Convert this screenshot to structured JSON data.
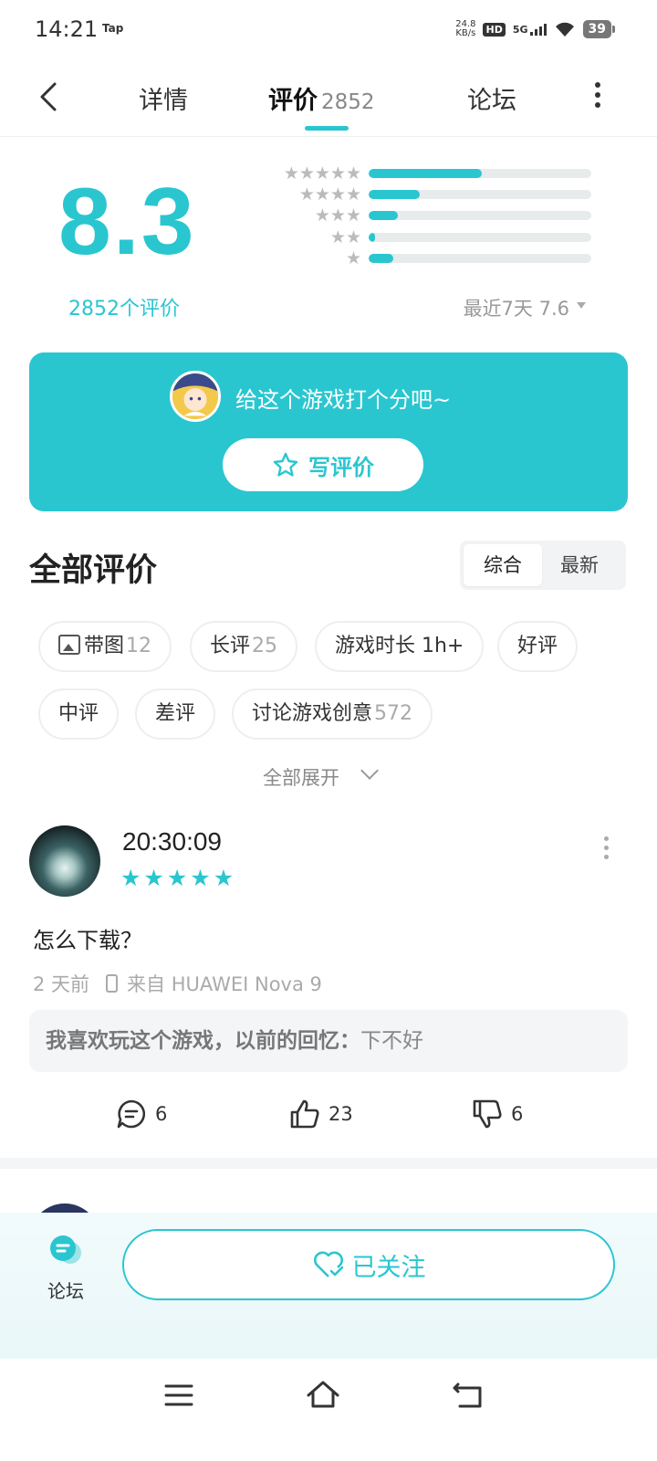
{
  "status_bar": {
    "time": "14:21",
    "carrier_tag": "Tap",
    "net_speed_value": "24.8",
    "net_speed_unit": "KB/s",
    "hd": "HD",
    "network": "5G",
    "battery": "39"
  },
  "nav": {
    "tabs": [
      {
        "label": "详情"
      },
      {
        "label": "评价",
        "count": "2852"
      },
      {
        "label": "论坛"
      }
    ],
    "active_tab": "评价"
  },
  "rating": {
    "score": "8.3",
    "count_label": "2852个评价",
    "recent_label": "最近7天 7.6",
    "distribution": [
      {
        "stars": 5,
        "fraction": 0.51
      },
      {
        "stars": 4,
        "fraction": 0.23
      },
      {
        "stars": 3,
        "fraction": 0.13
      },
      {
        "stars": 2,
        "fraction": 0.03
      },
      {
        "stars": 1,
        "fraction": 0.11
      }
    ],
    "accent_color": "#2ac6d0"
  },
  "cta": {
    "prompt": "给这个游戏打个分吧~",
    "button_label": "写评价"
  },
  "reviews_section": {
    "title": "全部评价",
    "sort_options": [
      "综合",
      "最新"
    ],
    "active_sort": "综合",
    "filters": [
      {
        "label": "带图",
        "count": "12"
      },
      {
        "label": "长评",
        "count": "25"
      },
      {
        "label": "游戏时长 1h+",
        "count": ""
      },
      {
        "label": "好评",
        "count": ""
      },
      {
        "label": "中评",
        "count": ""
      },
      {
        "label": "差评",
        "count": ""
      },
      {
        "label": "讨论游戏创意",
        "count": "572"
      }
    ],
    "expand_label": "全部展开"
  },
  "reviews": [
    {
      "name": "20:30:09",
      "rating": 5,
      "text": "怎么下载？",
      "time_ago": "2 天前",
      "device": "来自 HUAWEI Nova 9",
      "reply_prompt": "我喜欢玩这个游戏，以前的回忆：",
      "reply_answer": "下不好",
      "comments": "6",
      "likes": "23",
      "dislikes": "6"
    }
  ],
  "bottom_bar": {
    "forum_label": "论坛",
    "follow_label": "已关注"
  }
}
